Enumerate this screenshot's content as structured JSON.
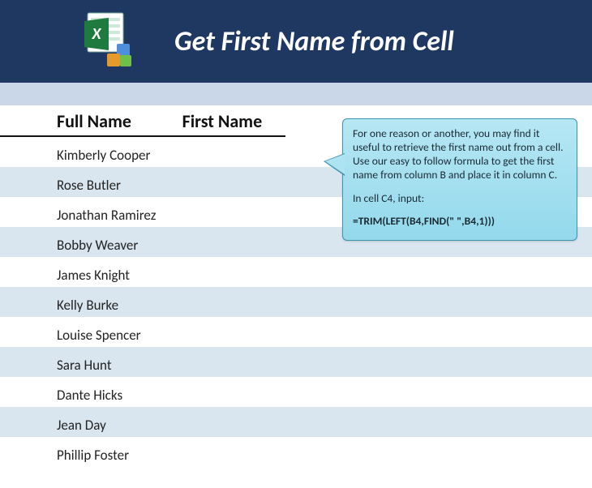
{
  "header": {
    "title": "Get First Name from Cell"
  },
  "columns": {
    "fullname": "Full Name",
    "firstname": "First Name"
  },
  "rows": [
    {
      "full": "Kimberly Cooper",
      "first": ""
    },
    {
      "full": "Rose Butler",
      "first": ""
    },
    {
      "full": "Jonathan Ramirez",
      "first": ""
    },
    {
      "full": "Bobby Weaver",
      "first": ""
    },
    {
      "full": "James Knight",
      "first": ""
    },
    {
      "full": "Kelly Burke",
      "first": ""
    },
    {
      "full": "Louise Spencer",
      "first": ""
    },
    {
      "full": "Sara Hunt",
      "first": ""
    },
    {
      "full": "Dante Hicks",
      "first": ""
    },
    {
      "full": "Jean Day",
      "first": ""
    },
    {
      "full": "Phillip Foster",
      "first": ""
    }
  ],
  "callout": {
    "p1": "For one reason or another, you may find it useful to retrieve the first name out from a cell. Use our easy to follow formula to get the first name from column B and place it in column C.",
    "p2": "In cell C4, input:",
    "formula": "=TRIM(LEFT(B4,FIND(\" \",B4,1)))"
  }
}
